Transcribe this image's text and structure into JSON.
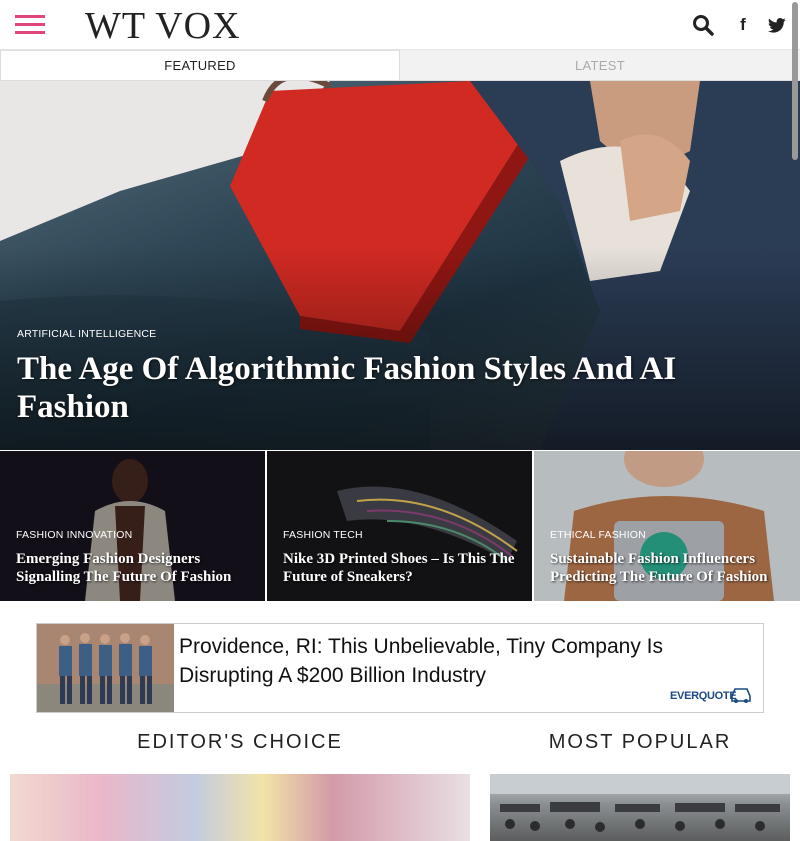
{
  "site": {
    "logo": "WT VOX"
  },
  "tabs": [
    {
      "label": "FEATURED",
      "active": true
    },
    {
      "label": "LATEST",
      "active": false
    }
  ],
  "hero": {
    "category": "ARTIFICIAL INTELLIGENCE",
    "title": "The Age Of Algorithmic Fashion Styles And AI Fashion"
  },
  "articles": [
    {
      "category": "FASHION INNOVATION",
      "title": "Emerging Fashion Designers Signalling The Future Of Fashion"
    },
    {
      "category": "FASHION TECH",
      "title": "Nike 3D Printed Shoes – Is This The Future of Sneakers?"
    },
    {
      "category": "ETHICAL FASHION",
      "title": "Sustainable Fashion Influencers Predicting The Future Of Fashion"
    }
  ],
  "ad": {
    "headline": "Providence, RI: This Unbelievable, Tiny Company Is Disrupting A $200 Billion Industry",
    "brand": "EVERQUOTE"
  },
  "sections": {
    "editors_choice": "EDITOR'S CHOICE",
    "most_popular": "MOST POPULAR"
  },
  "icons": {
    "menu": "hamburger-menu-icon",
    "search": "search-icon",
    "facebook": "facebook-icon",
    "twitter": "twitter-icon"
  },
  "colors": {
    "accent": "#e0457b",
    "text": "#222222"
  }
}
